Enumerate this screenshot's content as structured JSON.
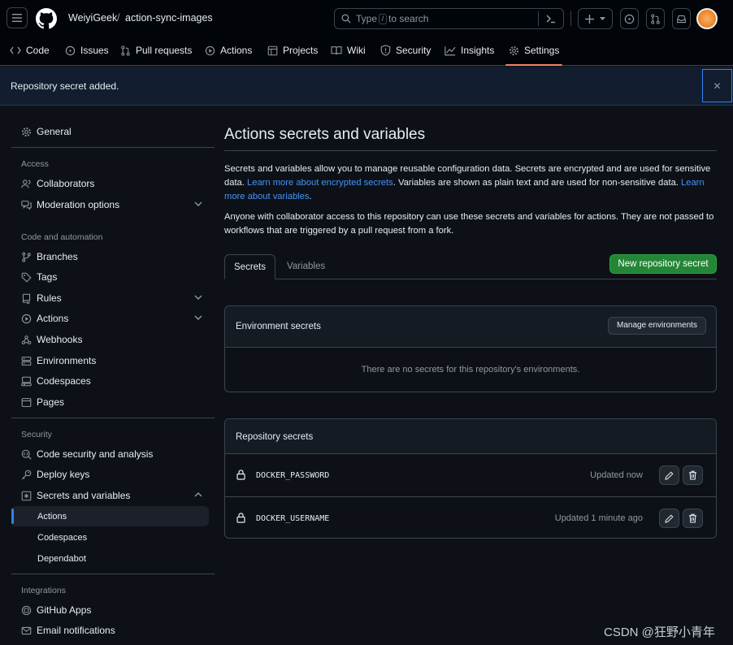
{
  "header": {
    "owner": "WeiyiGeek",
    "separator": "/",
    "repo": "action-sync-images",
    "search_prefix": "Type",
    "search_key": "/",
    "search_suffix": "to search"
  },
  "nav": {
    "tabs": [
      {
        "label": "Code",
        "icon": "code-icon"
      },
      {
        "label": "Issues",
        "icon": "issue-icon"
      },
      {
        "label": "Pull requests",
        "icon": "pull-request-icon"
      },
      {
        "label": "Actions",
        "icon": "play-icon"
      },
      {
        "label": "Projects",
        "icon": "table-icon"
      },
      {
        "label": "Wiki",
        "icon": "book-icon"
      },
      {
        "label": "Security",
        "icon": "shield-icon"
      },
      {
        "label": "Insights",
        "icon": "graph-icon"
      },
      {
        "label": "Settings",
        "icon": "gear-icon"
      }
    ],
    "active": "Settings"
  },
  "flash": {
    "message": "Repository secret added.",
    "close_glyph": "✕"
  },
  "sidebar": {
    "general": "General",
    "access_heading": "Access",
    "collaborators": "Collaborators",
    "moderation": "Moderation options",
    "code_heading": "Code and automation",
    "branches": "Branches",
    "tags": "Tags",
    "rules": "Rules",
    "actions": "Actions",
    "webhooks": "Webhooks",
    "environments": "Environments",
    "codespaces": "Codespaces",
    "pages": "Pages",
    "security_heading": "Security",
    "code_security": "Code security and analysis",
    "deploy_keys": "Deploy keys",
    "secrets_variables": "Secrets and variables",
    "sub_actions": "Actions",
    "sub_codespaces": "Codespaces",
    "sub_dependabot": "Dependabot",
    "integrations_heading": "Integrations",
    "github_apps": "GitHub Apps",
    "email_notifications": "Email notifications"
  },
  "main": {
    "title": "Actions secrets and variables",
    "para1_a": "Secrets and variables allow you to manage reusable configuration data. Secrets are encrypted and are used for sensitive data. ",
    "para1_link1": "Learn more about encrypted secrets",
    "para1_b": ". Variables are shown as plain text and are used for non-sensitive data. ",
    "para1_link2": "Learn more about variables",
    "para1_c": ".",
    "para2": "Anyone with collaborator access to this repository can use these secrets and variables for actions. They are not passed to workflows that are triggered by a pull request from a fork.",
    "tab_secrets": "Secrets",
    "tab_variables": "Variables",
    "new_secret_button": "New repository secret",
    "env_title": "Environment secrets",
    "manage_env_button": "Manage environments",
    "env_empty": "There are no secrets for this repository's environments.",
    "repo_title": "Repository secrets",
    "secrets": [
      {
        "name": "DOCKER_PASSWORD",
        "updated": "Updated now"
      },
      {
        "name": "DOCKER_USERNAME",
        "updated": "Updated 1 minute ago"
      }
    ]
  },
  "watermark": "CSDN @狂野小青年"
}
